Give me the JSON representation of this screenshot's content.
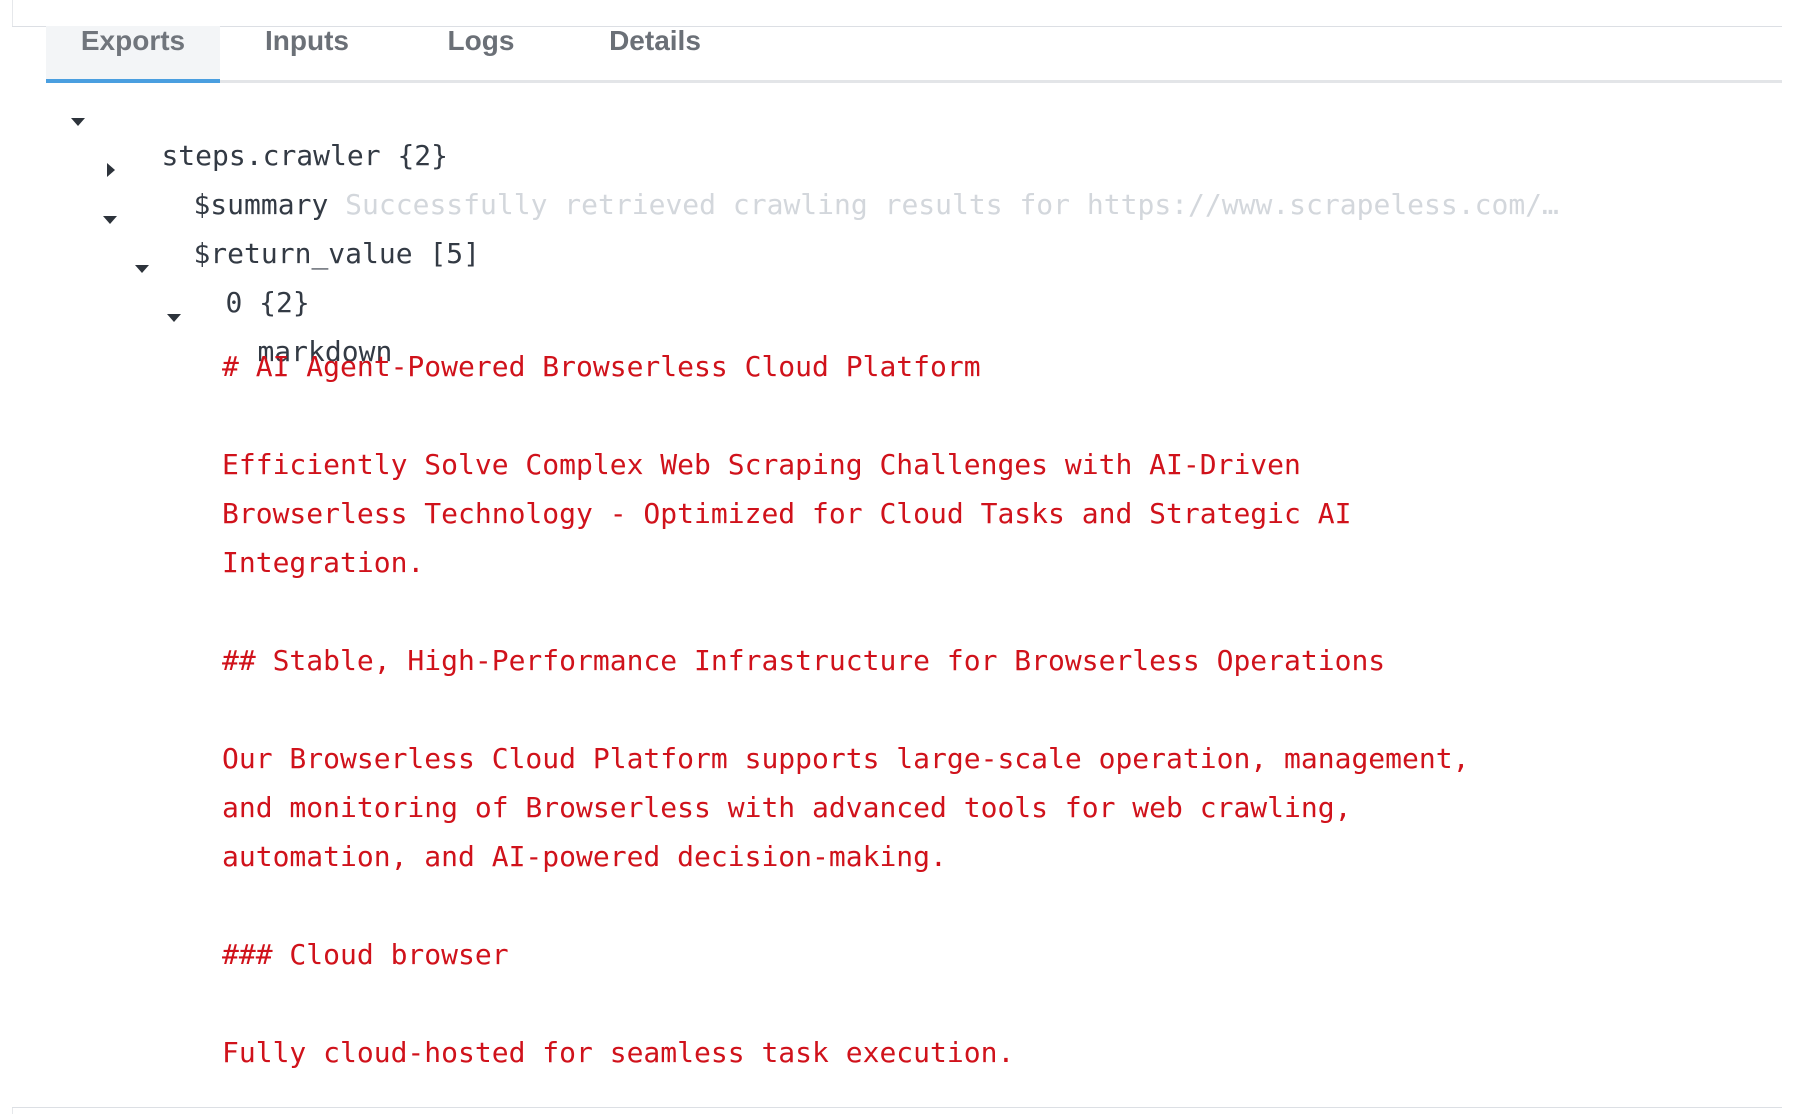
{
  "tabs": [
    {
      "label": "Exports",
      "active": true
    },
    {
      "label": "Inputs",
      "active": false
    },
    {
      "label": "Logs",
      "active": false
    },
    {
      "label": "Details",
      "active": false
    }
  ],
  "tree": {
    "root_key": "steps.crawler",
    "root_count": "{2}",
    "summary_key": "$summary",
    "summary_value": "Successfully retrieved crawling results for https://www.scrapeless.com/…",
    "return_key": "$return_value",
    "return_count": "[5]",
    "item_index": "0",
    "item_count": "{2}",
    "markdown_key": "markdown",
    "markdown_lines": [
      "# AI Agent-Powered Browserless Cloud Platform",
      "Efficiently Solve Complex Web Scraping Challenges with AI-Driven",
      "Browserless Technology - Optimized for Cloud Tasks and Strategic AI",
      "Integration.",
      "## Stable, High-Performance Infrastructure for Browserless Operations",
      "Our Browserless Cloud Platform supports large-scale operation, management,",
      "and monitoring of Browserless with advanced tools for web crawling,",
      "automation, and AI-powered decision-making.",
      "### Cloud browser",
      "Fully cloud-hosted for seamless task execution."
    ]
  },
  "colors": {
    "accent": "#4a9fe0",
    "value_text": "#d0121b",
    "key_text": "#333a44",
    "muted_text": "#d3d7dc"
  },
  "icons": {
    "expanded": "caret-down-icon",
    "collapsed": "caret-right-icon"
  }
}
